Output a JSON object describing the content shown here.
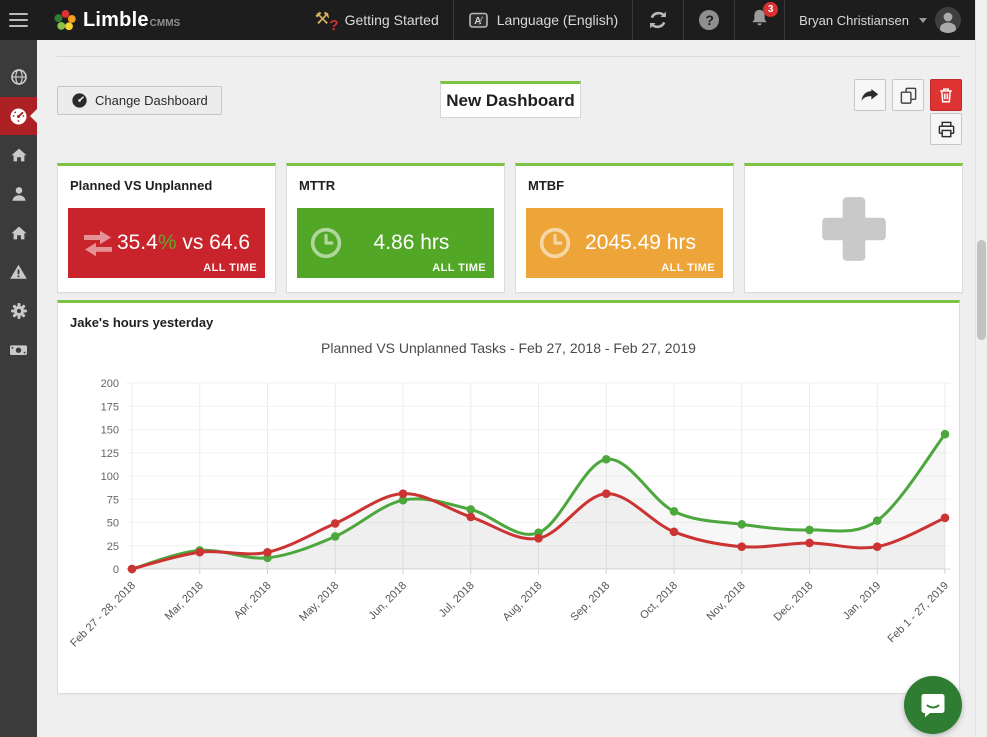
{
  "topbar": {
    "app_name": "Limble",
    "app_suffix": "CMMS",
    "getting_started_label": "Getting Started",
    "language_label": "Language (English)",
    "notification_badge": "3",
    "user_name": "Bryan Christiansen"
  },
  "sidebar": {
    "items": [
      {
        "icon": "globe-icon",
        "active": false
      },
      {
        "icon": "dashboard-gauge-icon",
        "active": true
      },
      {
        "icon": "home-icon",
        "active": false
      },
      {
        "icon": "user-icon",
        "active": false
      },
      {
        "icon": "asset-home-icon",
        "active": false
      },
      {
        "icon": "warning-triangle-icon",
        "active": false
      },
      {
        "icon": "gear-icon",
        "active": false
      },
      {
        "icon": "money-icon",
        "active": false
      }
    ]
  },
  "toolbar": {
    "change_dashboard_label": "Change Dashboard",
    "dashboard_title": "New Dashboard"
  },
  "kpi": {
    "pvu": {
      "title": "Planned VS Unplanned",
      "value_left": "35.4",
      "value_percent": "%",
      "value_right": " vs 64.6",
      "period": "ALL TIME",
      "bg_color": "#c9242b",
      "icon": "exchange-arrows-icon"
    },
    "mttr": {
      "title": "MTTR",
      "value": "4.86 hrs",
      "period": "ALL TIME",
      "bg_color": "#52a726",
      "icon": "clock-icon"
    },
    "mtbf": {
      "title": "MTBF",
      "value": "2045.49 hrs",
      "period": "ALL TIME",
      "bg_color": "#eda53a",
      "icon": "clock-icon"
    },
    "add": {
      "icon": "plus-icon"
    }
  },
  "panel": {
    "title": "Jake's hours yesterday"
  },
  "chart_data": {
    "type": "line",
    "title": "Planned VS Unplanned Tasks - Feb 27, 2018 - Feb 27, 2019",
    "categories": [
      "Feb 27 - 28, 2018",
      "Mar, 2018",
      "Apr, 2018",
      "May, 2018",
      "Jun, 2018",
      "Jul, 2018",
      "Aug, 2018",
      "Sep, 2018",
      "Oct, 2018",
      "Nov, 2018",
      "Dec, 2018",
      "Jan, 2019",
      "Feb 1 - 27, 2019"
    ],
    "series": [
      {
        "name": "green",
        "color": "#4ca73d",
        "values": [
          0,
          20,
          12,
          35,
          74,
          64,
          39,
          118,
          62,
          48,
          42,
          52,
          145
        ]
      },
      {
        "name": "red",
        "color": "#cc3333",
        "values": [
          0,
          18,
          18,
          49,
          81,
          56,
          33,
          81,
          40,
          24,
          28,
          24,
          55
        ]
      }
    ],
    "xlabel": "",
    "ylabel": "",
    "ylim": [
      0,
      200
    ],
    "yticks": [
      0,
      25,
      50,
      75,
      100,
      125,
      150,
      175,
      200
    ],
    "grid": true,
    "legend": "none",
    "area_fill": "rgba(0,0,0,0.032)"
  },
  "colors": {
    "accent_green": "#7dc242",
    "sidebar_active_red": "#ad2024",
    "delete_red": "#dd3333",
    "chat_green": "#2e7d32",
    "topbar_bg": "#1d1d1d",
    "sidebar_bg": "#3b3b3b"
  }
}
